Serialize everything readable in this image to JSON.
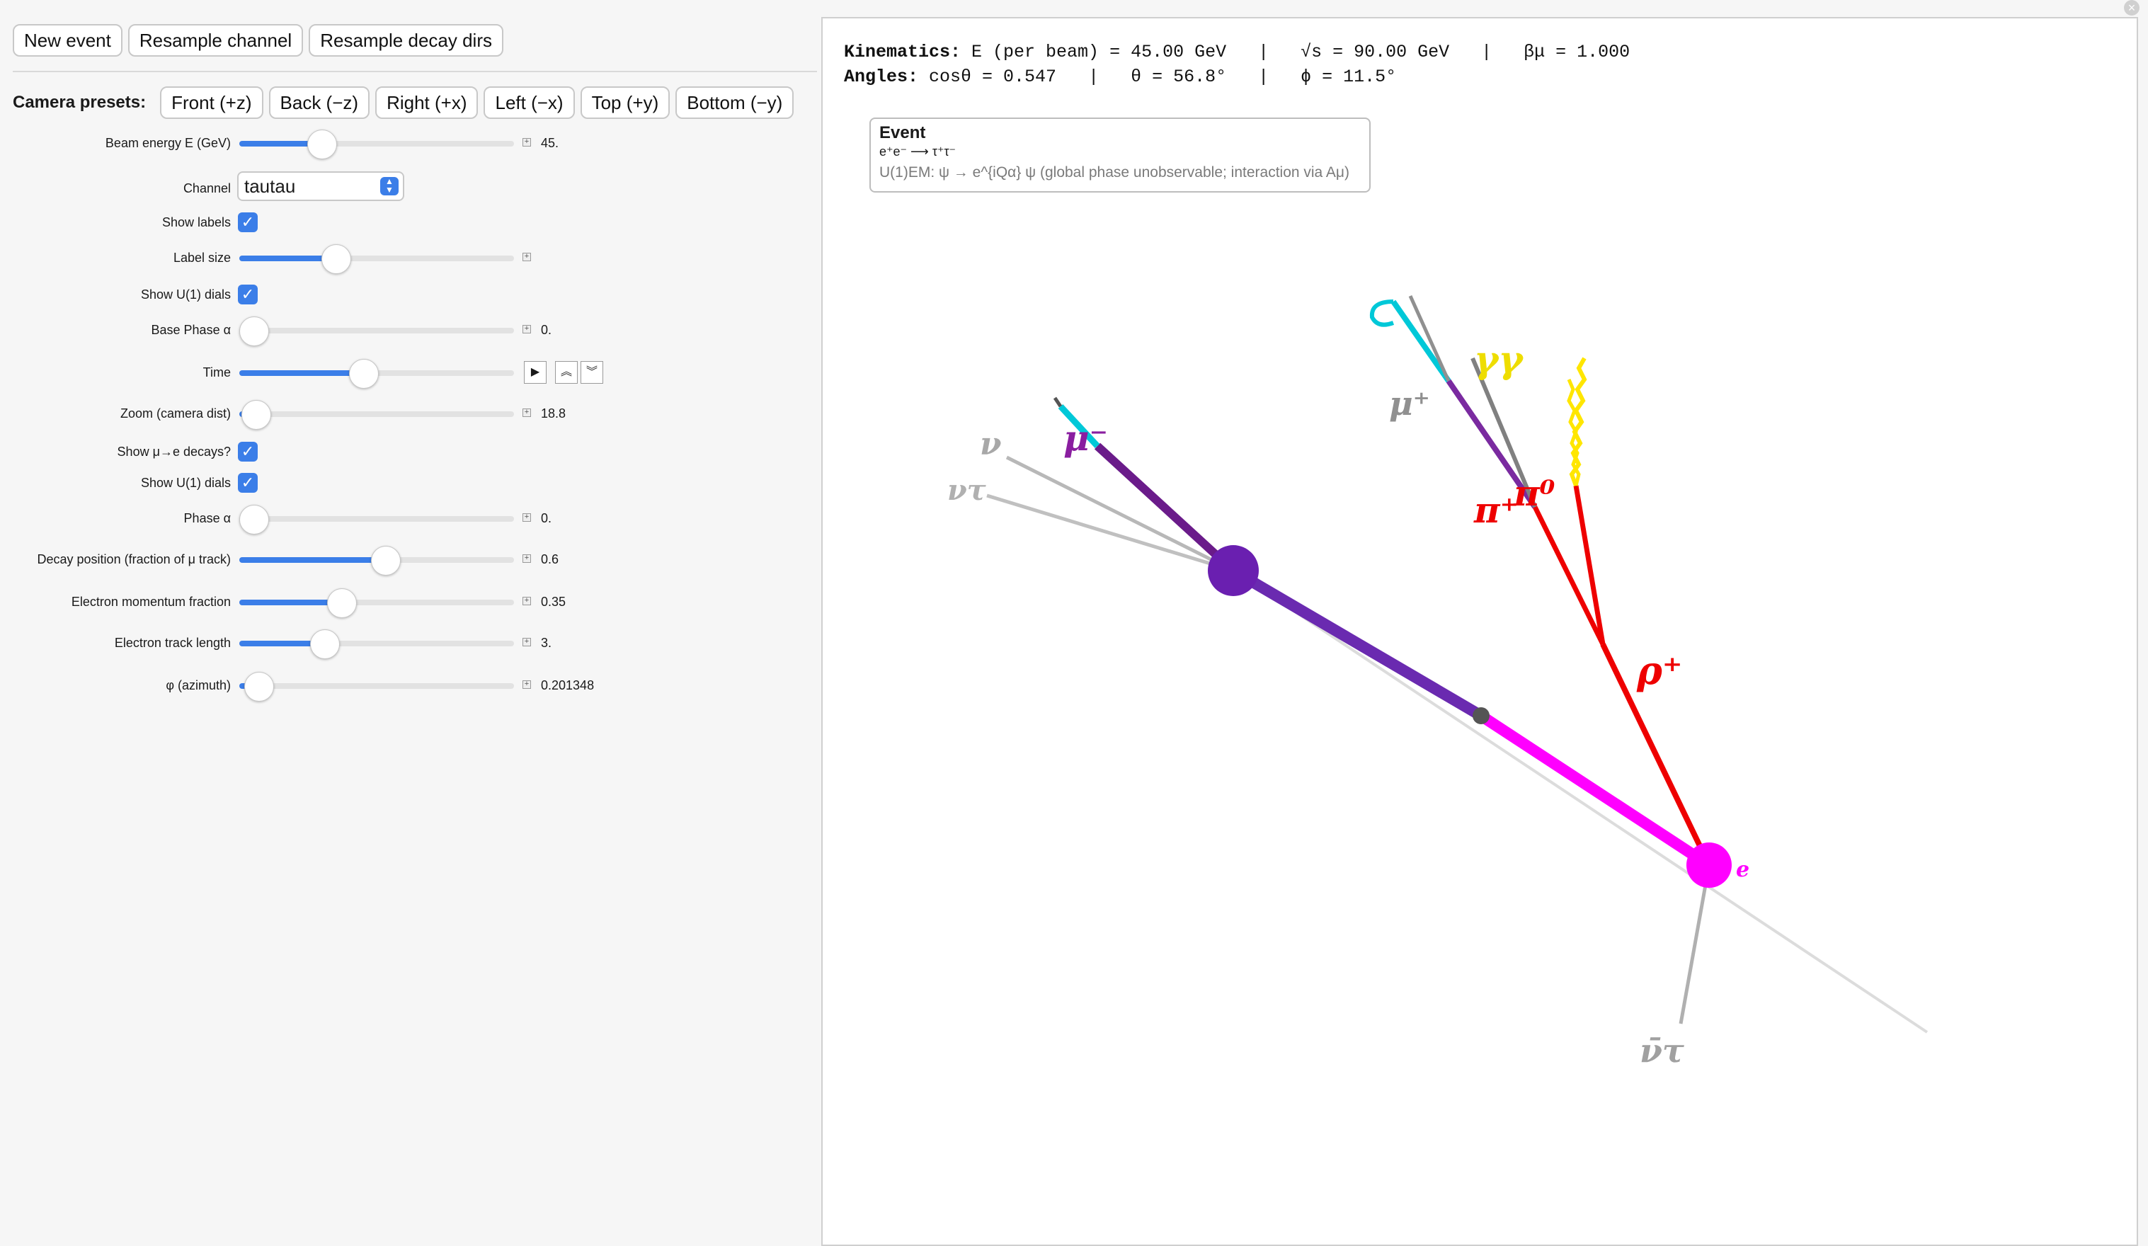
{
  "toolbar": {
    "new_event": "New event",
    "resample_channel": "Resample channel",
    "resample_decay_dirs": "Resample decay dirs"
  },
  "camera": {
    "label": "Camera presets:",
    "front": "Front (+z)",
    "back": "Back (−z)",
    "right": "Right (+x)",
    "left": "Left (−x)",
    "top": "Top (+y)",
    "bottom": "Bottom (−y)"
  },
  "controls": {
    "beam_energy": {
      "label": "Beam energy E (GeV)",
      "value": "45.",
      "fraction": 0.3
    },
    "channel": {
      "label": "Channel",
      "selected": "tautau"
    },
    "show_labels": {
      "label": "Show labels",
      "checked": true
    },
    "label_size": {
      "label": "Label size",
      "fraction": 0.35
    },
    "show_u1_dials": {
      "label": "Show U(1) dials",
      "checked": true
    },
    "base_phase": {
      "label": "Base Phase α",
      "value": "0.",
      "fraction": 0.0
    },
    "time": {
      "label": "Time",
      "fraction": 0.45
    },
    "zoom": {
      "label": "Zoom (camera dist)",
      "value": "18.8",
      "fraction": 0.06
    },
    "show_mu_e": {
      "label": "Show μ→e decays?",
      "checked": true
    },
    "show_u1_dials_2": {
      "label": "Show U(1) dials",
      "checked": true
    },
    "phase": {
      "label": "Phase α",
      "value": "0.",
      "fraction": 0.0
    },
    "decay_position": {
      "label": "Decay position (fraction of μ track)",
      "value": "0.6",
      "fraction": 0.53
    },
    "electron_momentum": {
      "label": "Electron momentum fraction",
      "value": "0.35",
      "fraction": 0.37
    },
    "electron_track": {
      "label": "Electron track length",
      "value": "3.",
      "fraction": 0.31
    },
    "azimuth": {
      "label": "φ (azimuth)",
      "value": "0.201348",
      "fraction": 0.07
    }
  },
  "kinematics": {
    "line1_label": "Kinematics:",
    "line1": " E (per beam) = 45.00 GeV   |   √s = 90.00 GeV   |   βμ = 1.000",
    "line2_label": "Angles:",
    "line2": " cosθ = 0.547   |   θ = 56.8°   |   ϕ = 11.5°"
  },
  "event_box": {
    "title": "Event",
    "process": "e⁺e⁻ ⟶ τ⁺τ⁻",
    "symmetry": "U(1)EM:  ψ → e^{iQα} ψ  (global phase unobservable; interaction via Aμ)"
  },
  "scene_labels": {
    "mu": "μ⁻",
    "nu_mu": "ν",
    "nu_tau_upper": "ντ",
    "nu_tau_lower": "ν̄τ",
    "rho_plus": "ρ⁺",
    "pi_plus": "π⁺",
    "pi_zero": "π⁰",
    "gamma": "γγ",
    "e_label": "e",
    "mu_plus": "μ⁺"
  },
  "colors": {
    "accent": "#3b7ee8",
    "tau_minus": "#7a1fa0",
    "tau_plus": "#ff00ff",
    "hadron": "#ff0000",
    "photon": "#ffee00",
    "electron": "#00c8d8",
    "neutrino": "#9a9a9a"
  }
}
